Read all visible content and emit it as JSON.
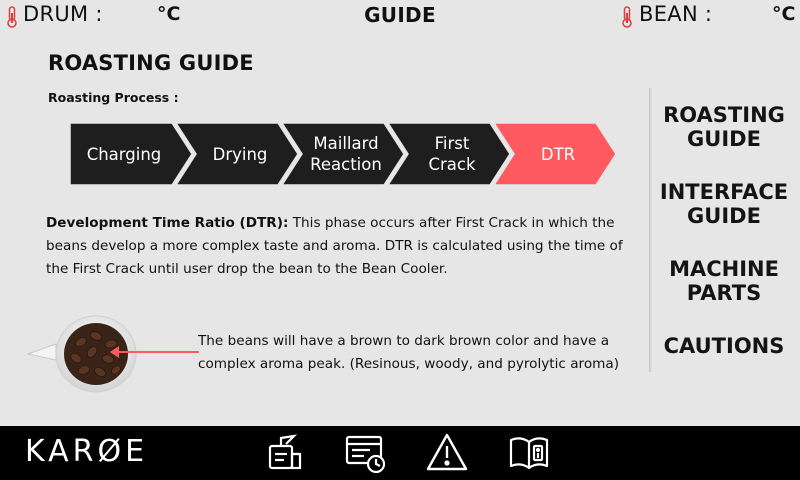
{
  "topbar": {
    "drum_label": "DRUM :",
    "drum_unit": "°C",
    "title": "GUIDE",
    "bean_label": "BEAN :",
    "bean_unit": "°C",
    "thermometer_icon": "thermometer-icon",
    "thermometer_color": "#e23b3b"
  },
  "main": {
    "title": "ROASTING GUIDE",
    "subheading": "Roasting Process :",
    "steps": [
      {
        "label": "Charging",
        "active": false
      },
      {
        "label": "Drying",
        "active": false
      },
      {
        "label": "Maillard\nReaction",
        "active": false
      },
      {
        "label": "First\nCrack",
        "active": false
      },
      {
        "label": "DTR",
        "active": true
      }
    ],
    "step_color": "#1e1e1e",
    "active_step_color": "#ff5a5f",
    "dtr_heading": "Development Time Ratio (DTR):",
    "dtr_text": " This phase occurs after First Crack in which the beans develop a more complex taste and aroma. DTR is calculated using the time of the First Crack until user drop the bean to the Bean Cooler.",
    "bean_note": "The beans will have a brown to dark brown color and have a complex aroma peak. (Resinous, woody, and pyrolytic aroma)",
    "bean_image": "coffee-bean-cup"
  },
  "nav": {
    "items": [
      {
        "label": "ROASTING\nGUIDE"
      },
      {
        "label": "INTERFACE\nGUIDE"
      },
      {
        "label": "MACHINE\nPARTS"
      },
      {
        "label": "CAUTIONS"
      }
    ]
  },
  "bottombar": {
    "brand": "KARØE",
    "icons": [
      "roaster-icon",
      "profile-list-icon",
      "warning-icon",
      "manual-book-icon"
    ]
  }
}
